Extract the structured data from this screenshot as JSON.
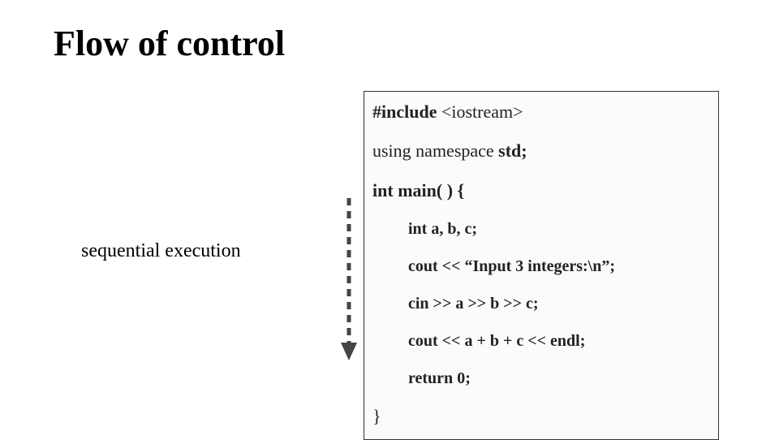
{
  "title": "Flow of control",
  "label": "sequential execution",
  "code": {
    "l1a": "#include",
    "l1b": " <iostream>",
    "l2a": "using namespace ",
    "l2b": "std;",
    "l3a": "int ",
    "l3b": "main( ) {",
    "i1a": "int ",
    "i1b": "a, b, c;",
    "i2": "cout << “Input 3 integers:\\n”;",
    "i3": "cin >> a >> b >> c;",
    "i4": "cout << a + b + c << endl;",
    "i5a": "return ",
    "i5b": "0;",
    "l_end": "}"
  }
}
